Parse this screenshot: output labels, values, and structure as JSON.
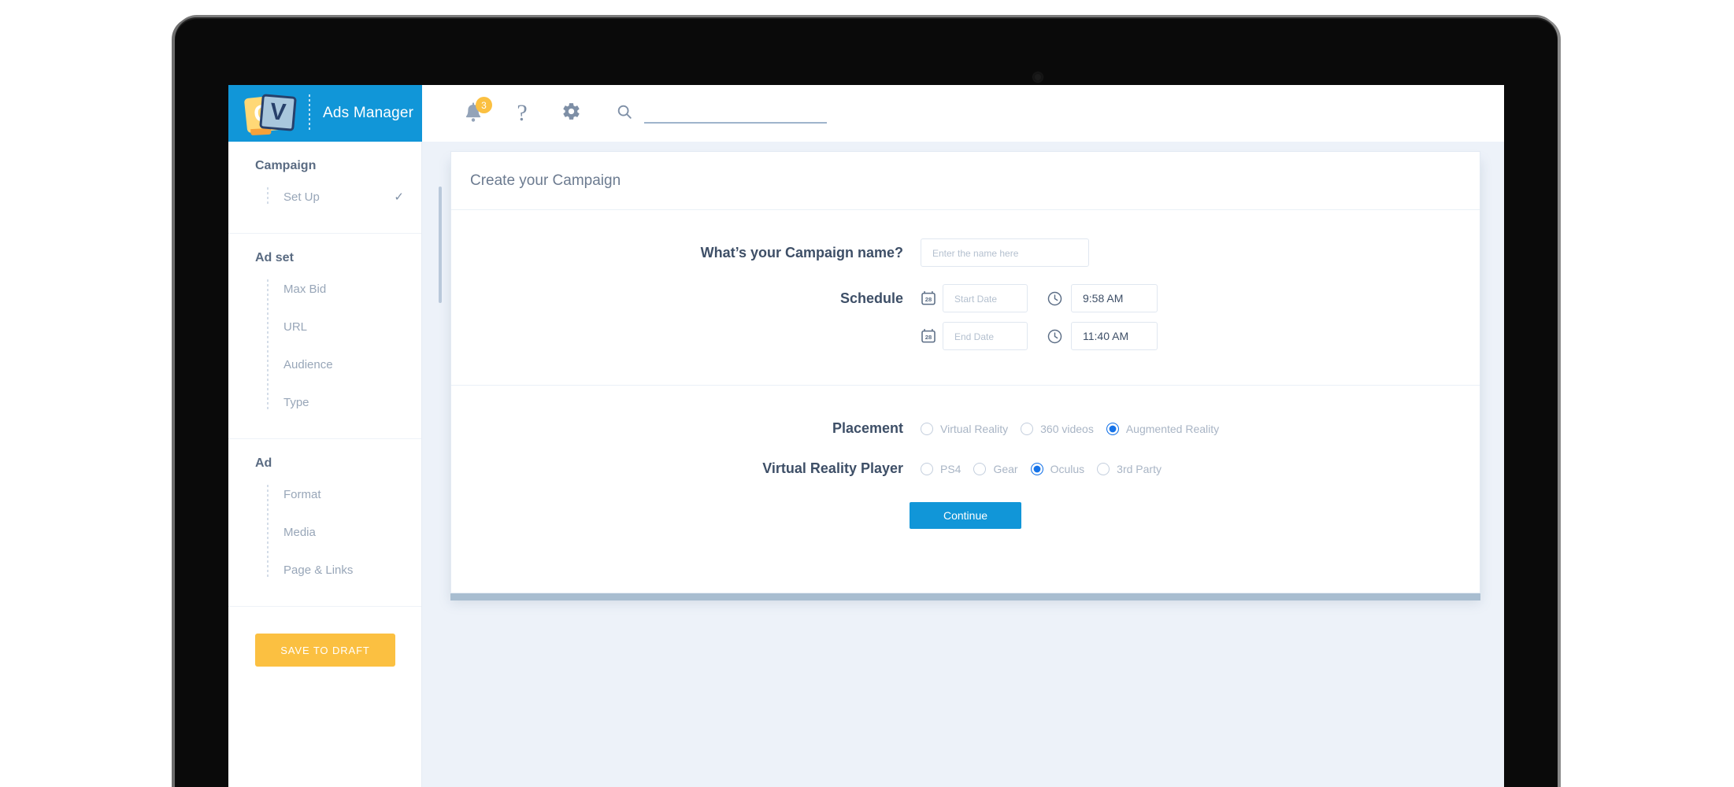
{
  "brand": {
    "logo_letters": {
      "left": "G",
      "right": "V"
    },
    "app_title": "Ads Manager",
    "brand_color": "#1196d8"
  },
  "topbar": {
    "notifications": {
      "icon": "bell-icon",
      "badge_count": "3",
      "badge_color": "#fbc041"
    },
    "help": {
      "icon": "question-mark-icon",
      "label": "?"
    },
    "settings": {
      "icon": "gear-icon"
    },
    "search": {
      "icon": "search-icon",
      "value": "",
      "placeholder": ""
    }
  },
  "sidebar": {
    "sections": [
      {
        "title": "Campaign",
        "items": [
          {
            "label": "Set Up",
            "completed": true,
            "check": "✓"
          }
        ]
      },
      {
        "title": "Ad set",
        "items": [
          {
            "label": "Max Bid",
            "completed": false
          },
          {
            "label": "URL",
            "completed": false
          },
          {
            "label": "Audience",
            "completed": false
          },
          {
            "label": "Type",
            "completed": false
          }
        ]
      },
      {
        "title": "Ad",
        "items": [
          {
            "label": "Format",
            "completed": false
          },
          {
            "label": "Media",
            "completed": false
          },
          {
            "label": "Page & Links",
            "completed": false
          }
        ]
      }
    ],
    "save_draft_label": "SAVE TO DRAFT",
    "save_draft_color": "#fbc041"
  },
  "main": {
    "card_title": "Create your Campaign",
    "campaign_name": {
      "label": "What’s your Campaign name?",
      "value": "",
      "placeholder": "Enter the name here"
    },
    "schedule": {
      "label": "Schedule",
      "calendar_icon_day": "28",
      "start": {
        "date_value": "",
        "date_placeholder": "Start Date",
        "time_value": "9:58 AM"
      },
      "end": {
        "date_value": "",
        "date_placeholder": "End Date",
        "time_value": "11:40 AM"
      }
    },
    "placement": {
      "label": "Placement",
      "options": [
        {
          "label": "Virtual Reality",
          "selected": false
        },
        {
          "label": "360 videos",
          "selected": false
        },
        {
          "label": "Augmented Reality",
          "selected": true
        }
      ]
    },
    "vr_player": {
      "label": "Virtual Reality Player",
      "options": [
        {
          "label": "PS4",
          "selected": false
        },
        {
          "label": "Gear",
          "selected": false
        },
        {
          "label": "Oculus",
          "selected": true
        },
        {
          "label": "3rd Party",
          "selected": false
        }
      ]
    },
    "continue_label": "Continue",
    "continue_color": "#1196d8"
  }
}
